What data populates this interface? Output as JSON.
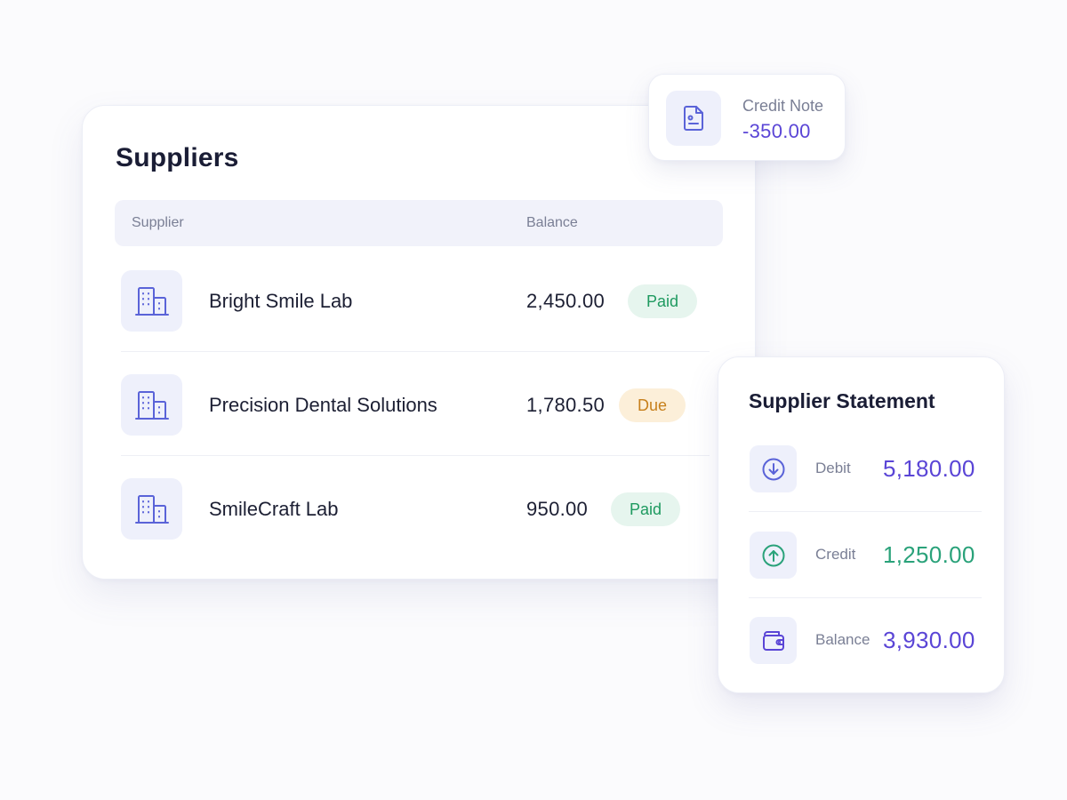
{
  "suppliers": {
    "title": "Suppliers",
    "columns": {
      "supplier": "Supplier",
      "balance": "Balance"
    },
    "rows": [
      {
        "name": "Bright Smile Lab",
        "amount": "2,450.00",
        "status": "Paid",
        "status_type": "paid",
        "icon": "building-icon"
      },
      {
        "name": "Precision Dental Solutions",
        "amount": "1,780.50",
        "status": "Due",
        "status_type": "due",
        "icon": "building-icon"
      },
      {
        "name": "SmileCraft Lab",
        "amount": "950.00",
        "status": "Paid",
        "status_type": "paid",
        "icon": "building-icon"
      }
    ]
  },
  "credit_note": {
    "label": "Credit Note",
    "value": "-350.00",
    "icon": "document-icon"
  },
  "statement": {
    "title": "Supplier Statement",
    "items": [
      {
        "label": "Debit",
        "value": "5,180.00",
        "icon": "arrow-down-circle-icon",
        "color": "#5a45d6"
      },
      {
        "label": "Credit",
        "value": "1,250.00",
        "icon": "arrow-up-circle-icon",
        "color": "#2aa27a"
      },
      {
        "label": "Balance",
        "value": "3,930.00",
        "icon": "wallet-icon",
        "color": "#5a45d6"
      }
    ]
  },
  "colors": {
    "accent_purple": "#5a45d6",
    "accent_green": "#2aa27a",
    "icon_blue": "#5a63d8",
    "paid_bg": "#e6f5ee",
    "paid_text": "#1f9a60",
    "due_bg": "#fcefd9",
    "due_text": "#c7801c"
  }
}
